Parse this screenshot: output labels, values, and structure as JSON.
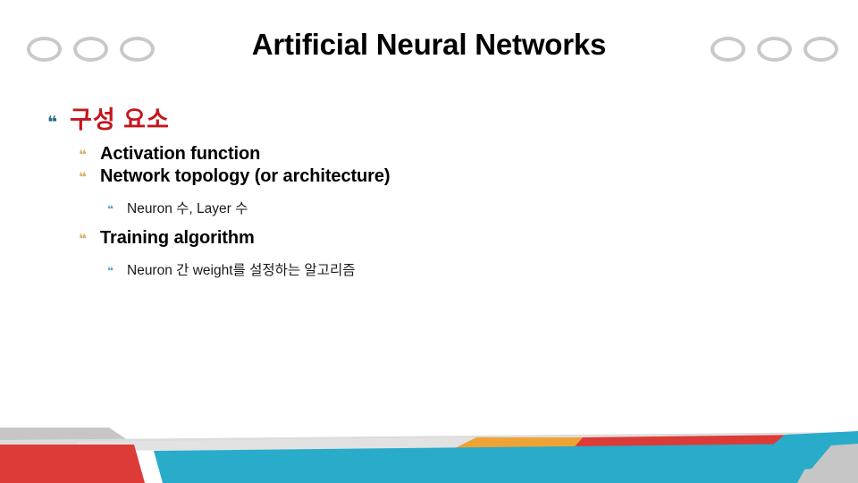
{
  "slide": {
    "title": "Artificial Neural Networks",
    "decor": {
      "ring_icon": "ring-icon",
      "ring_color": "#c9c9c9",
      "ring_count_left": 3,
      "ring_count_right": 3
    },
    "content": [
      {
        "level": 1,
        "bullet_glyph": "❝",
        "bullet_color": "#1f6b86",
        "text": "구성 요소",
        "text_color": "#C4161C"
      },
      {
        "level": 2,
        "bullet_glyph": "❝",
        "bullet_color": "#D6B26A",
        "text": "Activation function",
        "text_color": "#000000"
      },
      {
        "level": 2,
        "bullet_glyph": "❝",
        "bullet_color": "#D6B26A",
        "text": "Network topology (or architecture)",
        "text_color": "#000000"
      },
      {
        "level": 3,
        "bullet_glyph": "❝",
        "bullet_color": "#5BA8BE",
        "text": "Neuron 수, Layer 수",
        "text_color": "#1a1a1a"
      },
      {
        "level": 2,
        "bullet_glyph": "❝",
        "bullet_color": "#D6B26A",
        "text": "Training algorithm",
        "text_color": "#000000"
      },
      {
        "level": 3,
        "bullet_glyph": "❝",
        "bullet_color": "#5BA8BE",
        "text": "Neuron 간 weight를 설정하는 알고리즘",
        "text_color": "#1a1a1a"
      }
    ],
    "footer_colors": {
      "cyan": "#29ABCA",
      "red": "#DC3B38",
      "orange": "#EFA335",
      "gray_light": "#DCDCDC",
      "gray_mid": "#C6C6C6",
      "gray_dark": "#BDBDBD"
    }
  }
}
